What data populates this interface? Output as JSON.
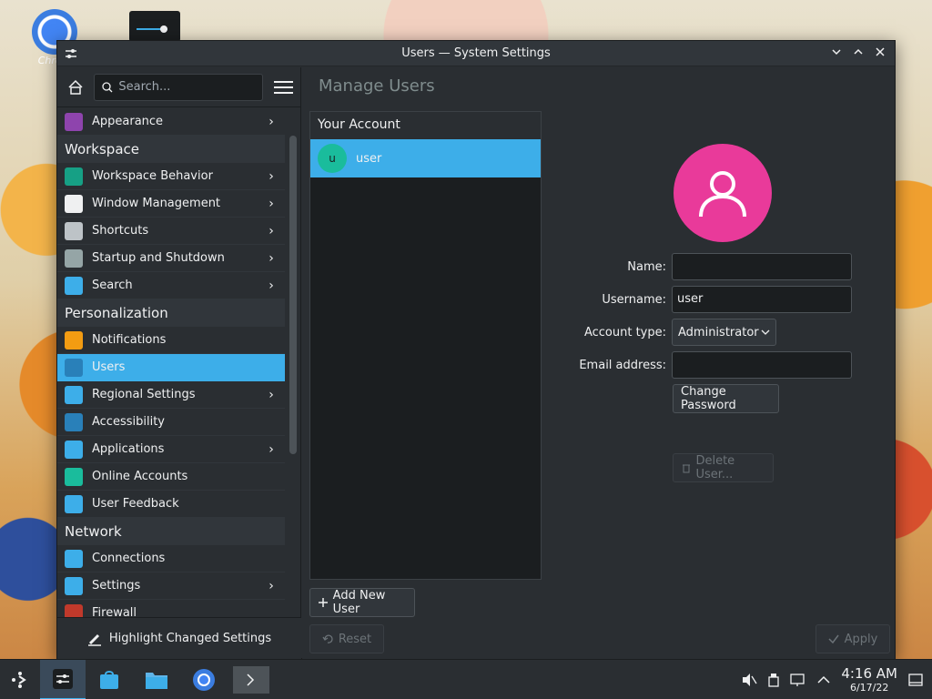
{
  "desktop": {
    "icon_label": "Chrom"
  },
  "window": {
    "title": "Users — System Settings",
    "controls": [
      "minimize",
      "maximize",
      "close"
    ]
  },
  "sidebar": {
    "search_placeholder": "Search...",
    "items": [
      {
        "type": "item",
        "label": "Appearance",
        "icon": "appearance-icon",
        "color": "#8e44ad",
        "chevron": true
      },
      {
        "type": "category",
        "label": "Workspace"
      },
      {
        "type": "item",
        "label": "Workspace Behavior",
        "icon": "workspace-behavior-icon",
        "color": "#16a085",
        "chevron": true
      },
      {
        "type": "item",
        "label": "Window Management",
        "icon": "window-management-icon",
        "color": "#eff0f1",
        "chevron": true
      },
      {
        "type": "item",
        "label": "Shortcuts",
        "icon": "keyboard-icon",
        "color": "#bdc3c7",
        "chevron": true
      },
      {
        "type": "item",
        "label": "Startup and Shutdown",
        "icon": "startup-icon",
        "color": "#95a5a6",
        "chevron": true
      },
      {
        "type": "item",
        "label": "Search",
        "icon": "search-icon",
        "color": "#3daee9",
        "chevron": true
      },
      {
        "type": "category",
        "label": "Personalization"
      },
      {
        "type": "item",
        "label": "Notifications",
        "icon": "bell-icon",
        "color": "#f39c12",
        "chevron": false
      },
      {
        "type": "item",
        "label": "Users",
        "icon": "users-icon",
        "color": "#2980b9",
        "chevron": false,
        "selected": true
      },
      {
        "type": "item",
        "label": "Regional Settings",
        "icon": "regional-icon",
        "color": "#3daee9",
        "chevron": true
      },
      {
        "type": "item",
        "label": "Accessibility",
        "icon": "accessibility-icon",
        "color": "#2980b9",
        "chevron": false
      },
      {
        "type": "item",
        "label": "Applications",
        "icon": "applications-icon",
        "color": "#3daee9",
        "chevron": true
      },
      {
        "type": "item",
        "label": "Online Accounts",
        "icon": "globe-icon",
        "color": "#1abc9c",
        "chevron": false
      },
      {
        "type": "item",
        "label": "User Feedback",
        "icon": "feedback-icon",
        "color": "#3daee9",
        "chevron": false
      },
      {
        "type": "category",
        "label": "Network"
      },
      {
        "type": "item",
        "label": "Connections",
        "icon": "connections-icon",
        "color": "#3daee9",
        "chevron": false
      },
      {
        "type": "item",
        "label": "Settings",
        "icon": "network-settings-icon",
        "color": "#3daee9",
        "chevron": true
      },
      {
        "type": "item",
        "label": "Firewall",
        "icon": "firewall-icon",
        "color": "#c0392b",
        "chevron": false
      }
    ],
    "footer_label": "Highlight Changed Settings"
  },
  "main": {
    "page_title": "Manage Users",
    "account_header": "Your Account",
    "selected_user": {
      "initial": "u",
      "name": "user"
    },
    "form": {
      "name_label": "Name:",
      "name_value": "",
      "username_label": "Username:",
      "username_value": "user",
      "account_type_label": "Account type:",
      "account_type_value": "Administrator",
      "email_label": "Email address:",
      "email_value": ""
    },
    "change_password": "Change Password",
    "delete_user": "Delete User...",
    "add_new_user": "Add New User",
    "reset": "Reset",
    "apply": "Apply"
  },
  "taskbar": {
    "time": "4:16 AM",
    "date": "6/17/22"
  }
}
